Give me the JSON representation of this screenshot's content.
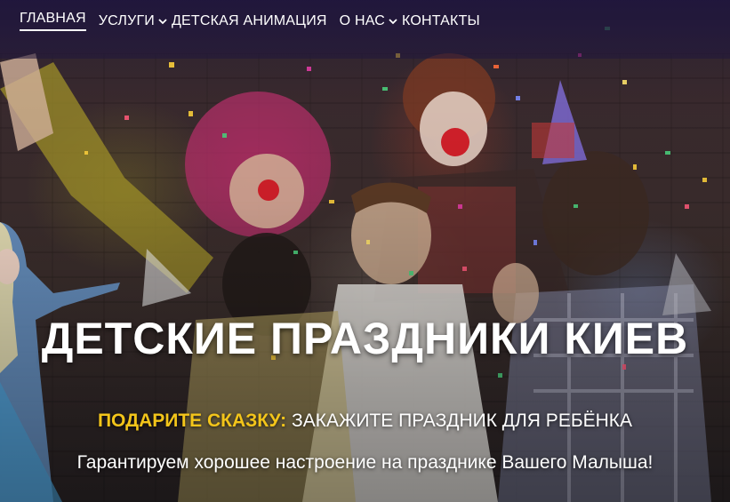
{
  "nav": {
    "items": [
      {
        "label": "ГЛАВНАЯ",
        "active": true,
        "has_dropdown": false
      },
      {
        "label": "УСЛУГИ",
        "active": false,
        "has_dropdown": true
      },
      {
        "label": "ДЕТСКАЯ АНИМАЦИЯ",
        "active": false,
        "has_dropdown": false
      },
      {
        "label": "О НАС",
        "active": false,
        "has_dropdown": true
      },
      {
        "label": "КОНТАКТЫ",
        "active": false,
        "has_dropdown": false
      }
    ],
    "dropdown_icon": "chevron-down-icon"
  },
  "hero": {
    "title": "ДЕТСКИЕ ПРАЗДНИКИ КИЕВ",
    "subtitle_accent": "ПОДАРИТЕ СКАЗКУ:",
    "subtitle_rest": " ЗАКАЖИТЕ ПРАЗДНИК ДЛЯ РЕБЁНКА",
    "tagline": "Гарантируем хорошее настроение на празднике Вашего Малыша!"
  },
  "colors": {
    "accent": "#f3c51a",
    "text": "#ffffff",
    "nav_bg": "#20163c"
  }
}
